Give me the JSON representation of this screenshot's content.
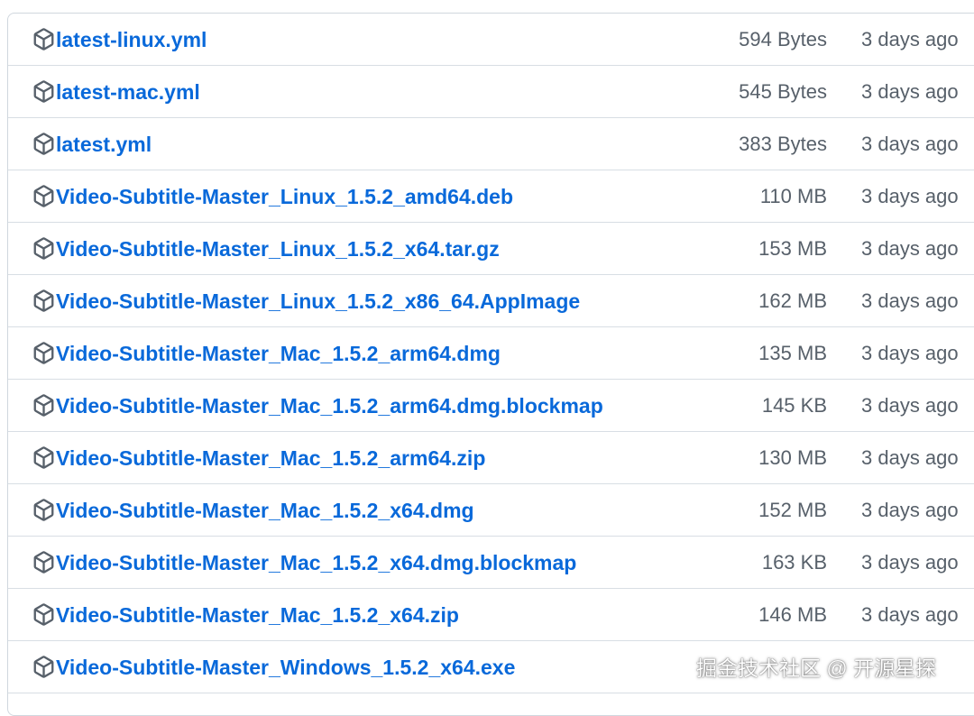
{
  "assets": [
    {
      "name": "latest-linux.yml",
      "size": "594 Bytes",
      "date": "3 days ago",
      "icon": "package-icon"
    },
    {
      "name": "latest-mac.yml",
      "size": "545 Bytes",
      "date": "3 days ago",
      "icon": "package-icon"
    },
    {
      "name": "latest.yml",
      "size": "383 Bytes",
      "date": "3 days ago",
      "icon": "package-icon"
    },
    {
      "name": "Video-Subtitle-Master_Linux_1.5.2_amd64.deb",
      "size": "110 MB",
      "date": "3 days ago",
      "icon": "package-icon"
    },
    {
      "name": "Video-Subtitle-Master_Linux_1.5.2_x64.tar.gz",
      "size": "153 MB",
      "date": "3 days ago",
      "icon": "package-icon"
    },
    {
      "name": "Video-Subtitle-Master_Linux_1.5.2_x86_64.AppImage",
      "size": "162 MB",
      "date": "3 days ago",
      "icon": "package-icon"
    },
    {
      "name": "Video-Subtitle-Master_Mac_1.5.2_arm64.dmg",
      "size": "135 MB",
      "date": "3 days ago",
      "icon": "package-icon"
    },
    {
      "name": "Video-Subtitle-Master_Mac_1.5.2_arm64.dmg.blockmap",
      "size": "145 KB",
      "date": "3 days ago",
      "icon": "package-icon"
    },
    {
      "name": "Video-Subtitle-Master_Mac_1.5.2_arm64.zip",
      "size": "130 MB",
      "date": "3 days ago",
      "icon": "package-icon"
    },
    {
      "name": "Video-Subtitle-Master_Mac_1.5.2_x64.dmg",
      "size": "152 MB",
      "date": "3 days ago",
      "icon": "package-icon"
    },
    {
      "name": "Video-Subtitle-Master_Mac_1.5.2_x64.dmg.blockmap",
      "size": "163 KB",
      "date": "3 days ago",
      "icon": "package-icon"
    },
    {
      "name": "Video-Subtitle-Master_Mac_1.5.2_x64.zip",
      "size": "146 MB",
      "date": "3 days ago",
      "icon": "package-icon"
    },
    {
      "name": "Video-Subtitle-Master_Windows_1.5.2_x64.exe",
      "size": "",
      "date": "",
      "icon": "package-icon"
    }
  ],
  "watermark": "掘金技术社区 @ 开源星探",
  "colors": {
    "link": "#0969da",
    "muted": "#57606a",
    "border": "#d0d7de"
  }
}
